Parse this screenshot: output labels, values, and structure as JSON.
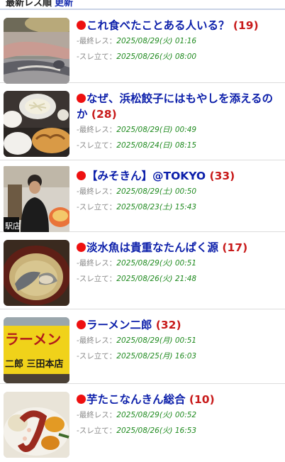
{
  "header": {
    "sort_label": "最新レス順",
    "refresh_label": "更新"
  },
  "meta_labels": {
    "last_res": "-最終レス：",
    "thread_start": "-スレ立て："
  },
  "threads": [
    {
      "title": "これ食べたことある人いる？",
      "count": "(19)",
      "last_res": "2025/08/29(火) 01:16",
      "thread_start": "2025/08/26(火) 08:00"
    },
    {
      "title": "なぜ、浜松餃子にはもやしを添えるのか",
      "count": "(28)",
      "last_res": "2025/08/29(日) 00:49",
      "thread_start": "2025/08/24(日) 08:15"
    },
    {
      "title": "【みそきん】@TOKYO",
      "count": "(33)",
      "last_res": "2025/08/29(土) 00:50",
      "thread_start": "2025/08/23(土) 15:43"
    },
    {
      "title": "淡水魚は貴重なたんぱく源",
      "count": "(17)",
      "last_res": "2025/08/29(火) 00:51",
      "thread_start": "2025/08/26(火) 21:48"
    },
    {
      "title": "ラーメン二郎",
      "count": "(32)",
      "last_res": "2025/08/29(月) 00:51",
      "thread_start": "2025/08/25(月) 16:03"
    },
    {
      "title": "芋たこなんきん総合",
      "count": "(10)",
      "last_res": "2025/08/29(火) 00:52",
      "thread_start": "2025/08/26(火) 16:53"
    }
  ],
  "thumb_signs": {
    "jiro_sign_top": "ラーメン",
    "jiro_sign_bottom": "二郎 三田本店",
    "misokin_caption": "駅店"
  }
}
